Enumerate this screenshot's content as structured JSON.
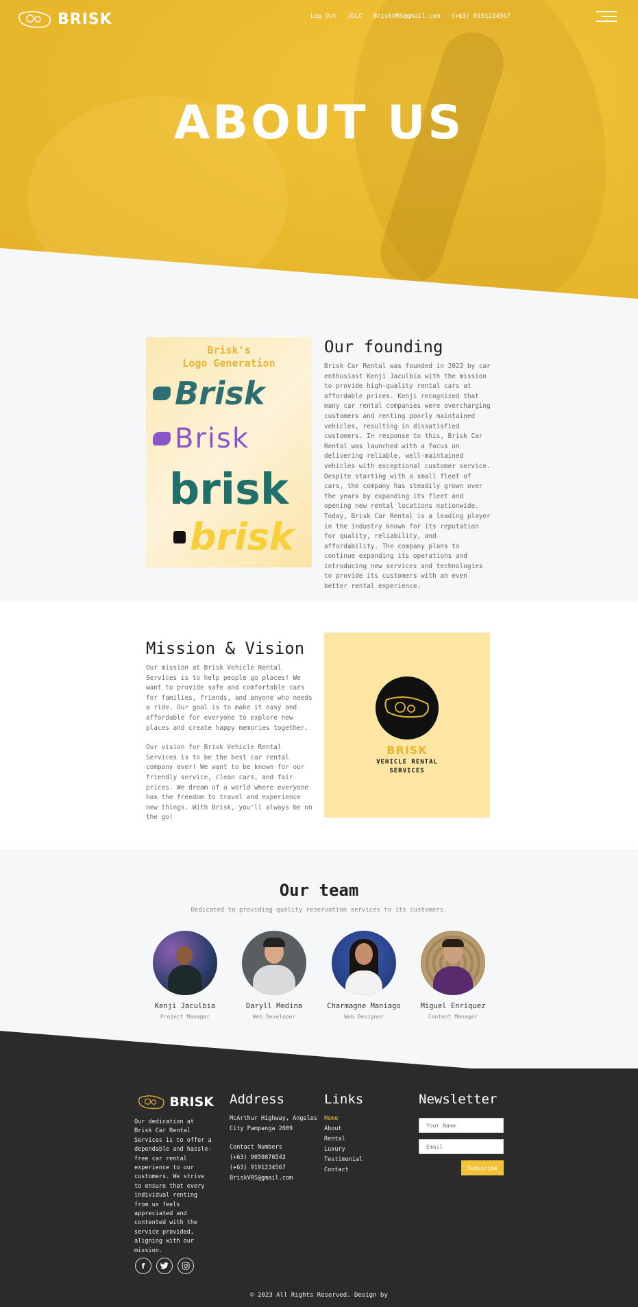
{
  "nav": {
    "brand": "BRISK",
    "links": [
      "Log Out",
      "JDLC",
      "BriskVRS@gmail.com",
      "(+63) 9191234567"
    ]
  },
  "hero": {
    "title": "ABOUT US"
  },
  "founding": {
    "image_title": "Brisk's\nLogo Generation",
    "logo_words": [
      "Brisk",
      "Brisk",
      "brisk",
      "brisk"
    ],
    "heading": "Our founding",
    "text": "Brisk Car Rental was founded in 2022 by car enthusiast Kenji Jaculbia with the mission to provide high-quality rental cars at affordable prices. Kenji recognized that many car rental companies were overcharging customers and renting poorly maintained vehicles, resulting in dissatisfied customers. In response to this, Brisk Car Rental was launched with a focus on delivering reliable, well-maintained vehicles with exceptional customer service. Despite starting with a small fleet of cars, the company has steadily grown over the years by expanding its fleet and opening new rental locations nationwide. Today, Brisk Car Rental is a leading player in the industry known for its reputation for quality, reliability, and affordability. The company plans to continue expanding its operations and introducing new services and technologies to provide its customers with an even better rental experience."
  },
  "mission": {
    "heading": "Mission & Vision",
    "mission_text": "Our mission at Brisk Vehicle Rental Services is to help people go places! We want to provide safe and comfortable cars for families, friends, and anyone who needs a ride. Our goal is to make it easy and affordable for everyone to explore new places and create happy memories together.",
    "vision_text": "Our vision for Brisk Vehicle Rental Services is to be the best car rental company ever! We want to be known for our friendly service, clean cars, and fair prices. We dream of a world where everyone has the freedom to travel and experience new things. With Brisk, you'll always be on the go!",
    "badge_name": "BRISK",
    "badge_sub": "VEHICLE RENTAL\nSERVICES"
  },
  "team": {
    "title": "Our team",
    "subtitle": "Dedicated to providing quality reservation services to its customers.",
    "members": [
      {
        "name": "Kenji Jaculbia",
        "role": "Project Manager"
      },
      {
        "name": "Daryll Medina",
        "role": "Web Developer"
      },
      {
        "name": "Charmagne Maniago",
        "role": "Web Designer"
      },
      {
        "name": "Miguel Enriquez",
        "role": "Content Manager"
      }
    ]
  },
  "footer": {
    "brand": "BRISK",
    "about": "Our dedication at Brisk Car Rental Services is to offer a dependable and hassle-free car rental experience to our customers. We strive to ensure that every individual renting from us feels appreciated and contented with the service provided, aligning with our mission.",
    "address_heading": "Address",
    "address": "McArthur Highway, Angeles City Pampanga 2009",
    "contact_label": "Contact Numbers",
    "phone1": "(+63) 9059876543",
    "phone2": "(+63) 9191234567",
    "email": "BriskVRS@gmail.com",
    "links_heading": "Links",
    "links": [
      "Home",
      "About",
      "Rental",
      "Luxury",
      "Testimonial",
      "Contact"
    ],
    "newsletter_heading": "Newsletter",
    "name_placeholder": "Your Name",
    "email_placeholder": "Email",
    "subscribe_label": "Subscribe",
    "copyright": "© 2023 All Rights Reserved. Design by"
  },
  "colors": {
    "accent": "#f2c33a",
    "footer_bg": "#2b2b2b",
    "panel": "#fde6a4"
  },
  "icons": [
    "headlight-logo-icon",
    "menu-icon",
    "facebook-icon",
    "twitter-icon",
    "instagram-icon"
  ]
}
